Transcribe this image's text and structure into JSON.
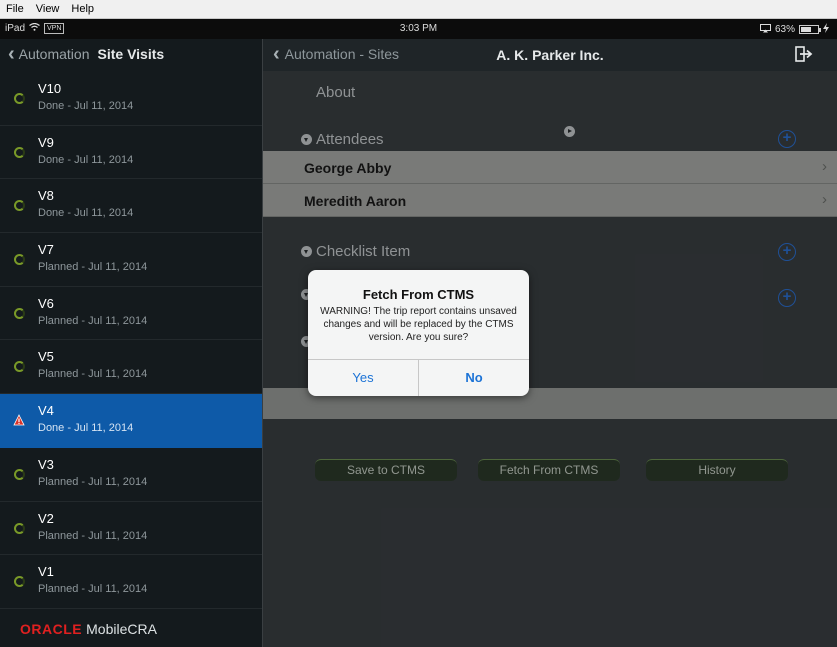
{
  "menubar": {
    "items": [
      "File",
      "View",
      "Help"
    ]
  },
  "statusbar": {
    "device": "iPad",
    "vpn": "VPN",
    "time": "3:03 PM",
    "battery": "63%",
    "battery_level": 0.63
  },
  "left": {
    "back_label": "Automation",
    "title": "Site Visits",
    "visits": [
      {
        "name": "V10",
        "status": "Done - Jul 11, 2014"
      },
      {
        "name": "V9",
        "status": "Done - Jul 11, 2014"
      },
      {
        "name": "V8",
        "status": "Done - Jul 11, 2014"
      },
      {
        "name": "V7",
        "status": "Planned - Jul 11, 2014"
      },
      {
        "name": "V6",
        "status": "Planned - Jul 11, 2014"
      },
      {
        "name": "V5",
        "status": "Planned - Jul 11, 2014"
      },
      {
        "name": "V4",
        "status": "Done - Jul 11, 2014",
        "selected": true,
        "icon": "warning-icon"
      },
      {
        "name": "V3",
        "status": "Planned - Jul 11, 2014"
      },
      {
        "name": "V2",
        "status": "Planned - Jul 11, 2014"
      },
      {
        "name": "V1",
        "status": "Planned - Jul 11, 2014"
      }
    ],
    "brand_oracle": "ORACLE",
    "brand_app": "MobileCRA"
  },
  "right": {
    "back_label": "Automation - Sites",
    "title": "A. K. Parker Inc.",
    "sections": {
      "about": "About",
      "attendees": "Attendees",
      "checklist": "Checklist Item"
    },
    "attendees": [
      "George Abby",
      "Meredith Aaron"
    ],
    "buttons": {
      "save": "Save to CTMS",
      "fetch": "Fetch From CTMS",
      "history": "History"
    }
  },
  "alert": {
    "title": "Fetch From CTMS",
    "message": "WARNING! The trip report contains unsaved changes and will be replaced by the CTMS version.  Are you sure?",
    "yes": "Yes",
    "no": "No"
  },
  "colors": {
    "selection": "#0e5aa8",
    "accent_blue": "#1c73d6",
    "oracle_red": "#e02020"
  }
}
